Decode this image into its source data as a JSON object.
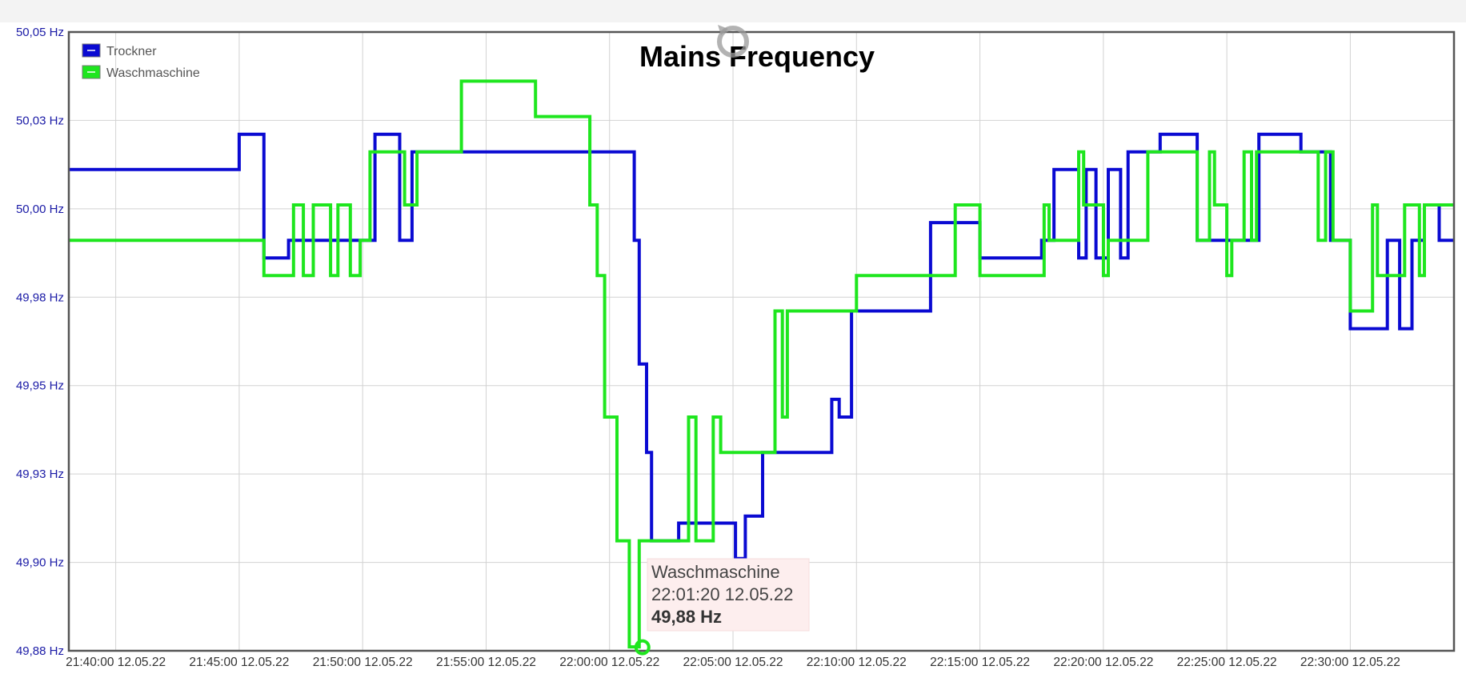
{
  "chart_data": {
    "type": "line",
    "step": true,
    "title": "Mains Frequency",
    "xlabel": "",
    "ylabel": "",
    "x_tick_labels": [
      "21:40:00 12.05.22",
      "21:45:00 12.05.22",
      "21:50:00 12.05.22",
      "21:55:00 12.05.22",
      "22:00:00 12.05.22",
      "22:05:00 12.05.22",
      "22:10:00 12.05.22",
      "22:15:00 12.05.22",
      "22:20:00 12.05.22",
      "22:25:00 12.05.22",
      "22:30:00 12.05.22"
    ],
    "x_tick_values": [
      0,
      5,
      10,
      15,
      20,
      25,
      30,
      35,
      40,
      45,
      50
    ],
    "xlim": [
      -1.9,
      54.2
    ],
    "y_tick_labels": [
      "49,88 Hz",
      "49,90 Hz",
      "49,93 Hz",
      "49,95 Hz",
      "49,98 Hz",
      "50,00 Hz",
      "50,03 Hz",
      "50,05 Hz"
    ],
    "y_tick_values": [
      49.875,
      49.9,
      49.925,
      49.95,
      49.975,
      50.0,
      50.025,
      50.05
    ],
    "ylim": [
      49.875,
      50.05
    ],
    "grid": true,
    "legend_position": "top-left",
    "colors": {
      "Trockner": "#0a0ad2",
      "Waschmaschine": "#1ee61e"
    },
    "series": [
      {
        "name": "Trockner",
        "points": [
          [
            -1.9,
            50.0111
          ],
          [
            5.0,
            50.0111
          ],
          [
            5.0,
            50.0211
          ],
          [
            6.0,
            50.0211
          ],
          [
            6.0,
            49.9861
          ],
          [
            7.0,
            49.9861
          ],
          [
            7.0,
            49.9911
          ],
          [
            10.5,
            49.9911
          ],
          [
            10.5,
            50.0211
          ],
          [
            11.5,
            50.0211
          ],
          [
            11.5,
            49.9911
          ],
          [
            12.0,
            49.9911
          ],
          [
            12.0,
            50.0161
          ],
          [
            21.0,
            50.0161
          ],
          [
            21.0,
            49.9911
          ],
          [
            21.2,
            49.9911
          ],
          [
            21.2,
            49.9561
          ],
          [
            21.5,
            49.9561
          ],
          [
            21.5,
            49.9311
          ],
          [
            21.7,
            49.9311
          ],
          [
            21.7,
            49.9061
          ],
          [
            22.8,
            49.9061
          ],
          [
            22.8,
            49.9111
          ],
          [
            25.1,
            49.9111
          ],
          [
            25.1,
            49.9011
          ],
          [
            25.5,
            49.9011
          ],
          [
            25.5,
            49.9131
          ],
          [
            26.2,
            49.9131
          ],
          [
            26.2,
            49.9311
          ],
          [
            29.0,
            49.9311
          ],
          [
            29.0,
            49.9461
          ],
          [
            29.3,
            49.9461
          ],
          [
            29.3,
            49.9411
          ],
          [
            29.8,
            49.9411
          ],
          [
            29.8,
            49.9711
          ],
          [
            33.0,
            49.9711
          ],
          [
            33.0,
            49.9961
          ],
          [
            35.0,
            49.9961
          ],
          [
            35.0,
            49.9861
          ],
          [
            37.5,
            49.9861
          ],
          [
            37.5,
            49.9911
          ],
          [
            38.0,
            49.9911
          ],
          [
            38.0,
            50.0111
          ],
          [
            39.0,
            50.0111
          ],
          [
            39.0,
            49.9861
          ],
          [
            39.3,
            49.9861
          ],
          [
            39.3,
            50.0111
          ],
          [
            39.7,
            50.0111
          ],
          [
            39.7,
            49.9861
          ],
          [
            40.2,
            49.9861
          ],
          [
            40.2,
            50.0111
          ],
          [
            40.7,
            50.0111
          ],
          [
            40.7,
            49.9861
          ],
          [
            41.0,
            49.9861
          ],
          [
            41.0,
            50.0161
          ],
          [
            42.3,
            50.0161
          ],
          [
            42.3,
            50.0211
          ],
          [
            43.8,
            50.0211
          ],
          [
            43.8,
            49.9911
          ],
          [
            46.3,
            49.9911
          ],
          [
            46.3,
            50.0211
          ],
          [
            48.0,
            50.0211
          ],
          [
            48.0,
            50.0161
          ],
          [
            49.2,
            50.0161
          ],
          [
            49.2,
            49.9911
          ],
          [
            50.0,
            49.9911
          ],
          [
            50.0,
            49.9661
          ],
          [
            51.5,
            49.9661
          ],
          [
            51.5,
            49.9911
          ],
          [
            52.0,
            49.9911
          ],
          [
            52.0,
            49.9661
          ],
          [
            52.5,
            49.9661
          ],
          [
            52.5,
            49.9911
          ],
          [
            53.0,
            49.9911
          ],
          [
            53.0,
            50.0011
          ],
          [
            53.6,
            50.0011
          ],
          [
            53.6,
            49.9911
          ],
          [
            54.2,
            49.9911
          ]
        ]
      },
      {
        "name": "Waschmaschine",
        "points": [
          [
            -1.9,
            49.9911
          ],
          [
            6.0,
            49.9911
          ],
          [
            6.0,
            49.9811
          ],
          [
            7.2,
            49.9811
          ],
          [
            7.2,
            50.0011
          ],
          [
            7.6,
            50.0011
          ],
          [
            7.6,
            49.9811
          ],
          [
            8.0,
            49.9811
          ],
          [
            8.0,
            50.0011
          ],
          [
            8.7,
            50.0011
          ],
          [
            8.7,
            49.9811
          ],
          [
            9.0,
            49.9811
          ],
          [
            9.0,
            50.0011
          ],
          [
            9.5,
            50.0011
          ],
          [
            9.5,
            49.9811
          ],
          [
            9.9,
            49.9811
          ],
          [
            9.9,
            49.9911
          ],
          [
            10.3,
            49.9911
          ],
          [
            10.3,
            50.0161
          ],
          [
            11.7,
            50.0161
          ],
          [
            11.7,
            50.0011
          ],
          [
            12.2,
            50.0011
          ],
          [
            12.2,
            50.0161
          ],
          [
            14.0,
            50.0161
          ],
          [
            14.0,
            50.0361
          ],
          [
            17.0,
            50.0361
          ],
          [
            17.0,
            50.0261
          ],
          [
            19.2,
            50.0261
          ],
          [
            19.2,
            50.0011
          ],
          [
            19.5,
            50.0011
          ],
          [
            19.5,
            49.9811
          ],
          [
            19.8,
            49.9811
          ],
          [
            19.8,
            49.9411
          ],
          [
            20.3,
            49.9411
          ],
          [
            20.3,
            49.9061
          ],
          [
            20.8,
            49.9061
          ],
          [
            20.8,
            49.8761
          ],
          [
            21.2,
            49.8761
          ],
          [
            21.2,
            49.9061
          ],
          [
            23.2,
            49.9061
          ],
          [
            23.2,
            49.9411
          ],
          [
            23.5,
            49.9411
          ],
          [
            23.5,
            49.9061
          ],
          [
            24.2,
            49.9061
          ],
          [
            24.2,
            49.9411
          ],
          [
            24.5,
            49.9411
          ],
          [
            24.5,
            49.9311
          ],
          [
            26.7,
            49.9311
          ],
          [
            26.7,
            49.9711
          ],
          [
            27.0,
            49.9711
          ],
          [
            27.0,
            49.9411
          ],
          [
            27.2,
            49.9411
          ],
          [
            27.2,
            49.9711
          ],
          [
            30.0,
            49.9711
          ],
          [
            30.0,
            49.9811
          ],
          [
            34.0,
            49.9811
          ],
          [
            34.0,
            50.0011
          ],
          [
            35.0,
            50.0011
          ],
          [
            35.0,
            49.9811
          ],
          [
            37.6,
            49.9811
          ],
          [
            37.6,
            50.0011
          ],
          [
            37.8,
            50.0011
          ],
          [
            37.8,
            49.9911
          ],
          [
            39.0,
            49.9911
          ],
          [
            39.0,
            50.0161
          ],
          [
            39.2,
            50.0161
          ],
          [
            39.2,
            50.0011
          ],
          [
            40.0,
            50.0011
          ],
          [
            40.0,
            49.9811
          ],
          [
            40.2,
            49.9811
          ],
          [
            40.2,
            49.9911
          ],
          [
            41.8,
            49.9911
          ],
          [
            41.8,
            50.0161
          ],
          [
            43.8,
            50.0161
          ],
          [
            43.8,
            49.9911
          ],
          [
            44.3,
            49.9911
          ],
          [
            44.3,
            50.0161
          ],
          [
            44.5,
            50.0161
          ],
          [
            44.5,
            50.0011
          ],
          [
            45.0,
            50.0011
          ],
          [
            45.0,
            49.9811
          ],
          [
            45.2,
            49.9811
          ],
          [
            45.2,
            49.9911
          ],
          [
            45.7,
            49.9911
          ],
          [
            45.7,
            50.0161
          ],
          [
            46.0,
            50.0161
          ],
          [
            46.0,
            49.9911
          ],
          [
            46.2,
            49.9911
          ],
          [
            46.2,
            50.0161
          ],
          [
            48.7,
            50.0161
          ],
          [
            48.7,
            49.9911
          ],
          [
            49.0,
            49.9911
          ],
          [
            49.0,
            50.0161
          ],
          [
            49.3,
            50.0161
          ],
          [
            49.3,
            49.9911
          ],
          [
            50.0,
            49.9911
          ],
          [
            50.0,
            49.9711
          ],
          [
            50.9,
            49.9711
          ],
          [
            50.9,
            50.0011
          ],
          [
            51.1,
            50.0011
          ],
          [
            51.1,
            49.9811
          ],
          [
            52.2,
            49.9811
          ],
          [
            52.2,
            50.0011
          ],
          [
            52.8,
            50.0011
          ],
          [
            52.8,
            49.9811
          ],
          [
            53.0,
            49.9811
          ],
          [
            53.0,
            50.0011
          ],
          [
            54.2,
            50.0011
          ]
        ]
      }
    ],
    "tooltip": {
      "series": "Waschmaschine",
      "time": "22:01:20 12.05.22",
      "value_label": "49,88 Hz",
      "x": 21.33,
      "y": 49.876
    }
  }
}
